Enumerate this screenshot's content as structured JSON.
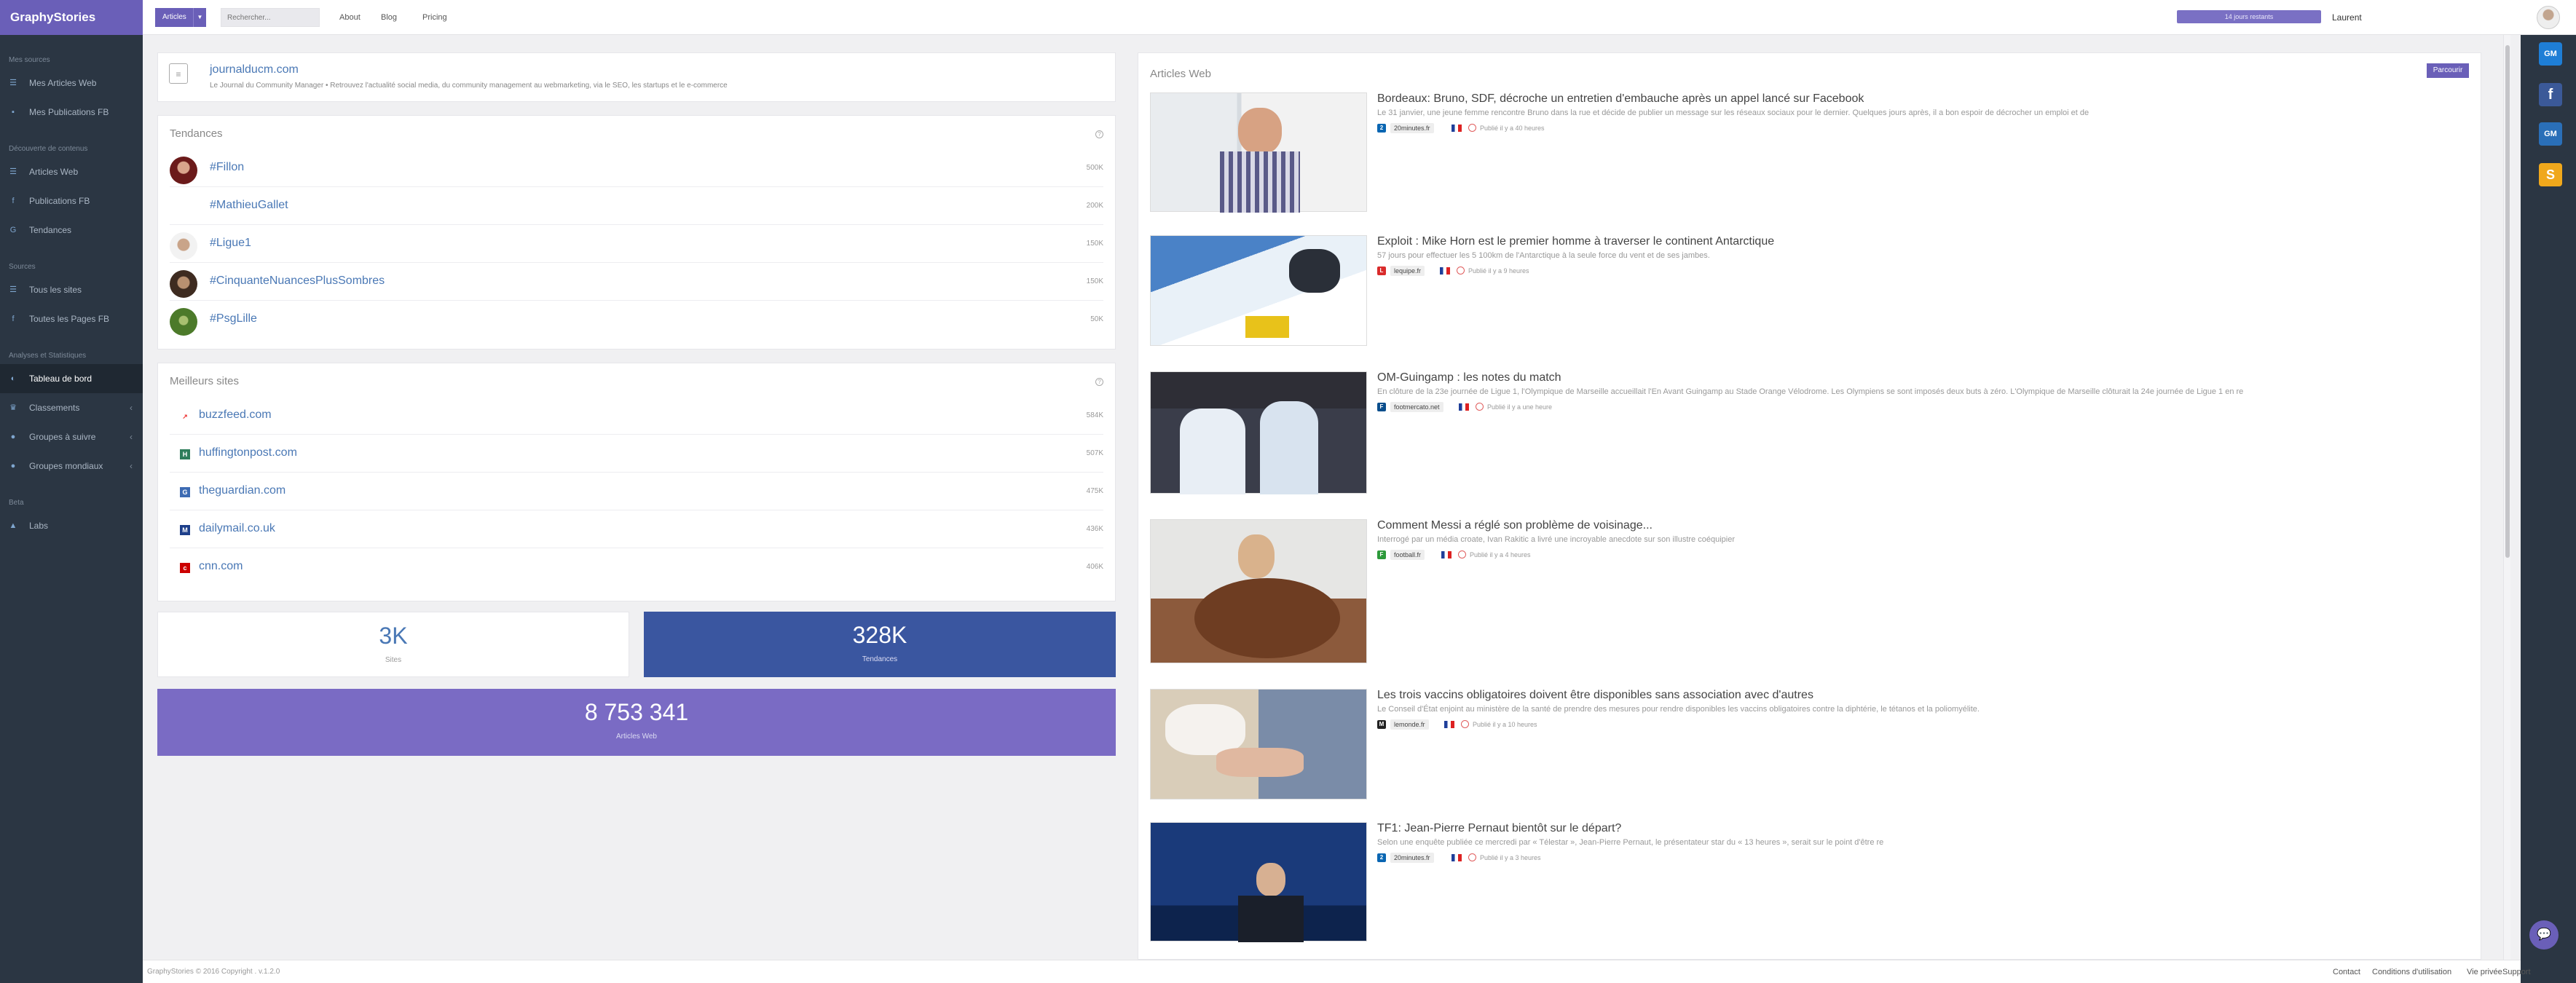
{
  "brand": "GraphyStories",
  "sidebar": {
    "sections": [
      {
        "label": "Mes sources",
        "items": [
          {
            "label": "Mes Articles Web",
            "icon": "list-icon"
          },
          {
            "label": "Mes Publications FB",
            "icon": "facebook-icon"
          }
        ]
      },
      {
        "label": "Découverte de contenus",
        "items": [
          {
            "label": "Articles Web",
            "icon": "list-icon"
          },
          {
            "label": "Publications FB",
            "icon": "facebook-icon"
          },
          {
            "label": "Tendances",
            "icon": "hashtag-icon"
          }
        ]
      },
      {
        "label": "Sources",
        "items": [
          {
            "label": "Tous les sites",
            "icon": "list-icon"
          },
          {
            "label": "Toutes les Pages FB",
            "icon": "facebook-icon"
          }
        ]
      },
      {
        "label": "Analyses et Statistiques",
        "items": [
          {
            "label": "Tableau de bord",
            "icon": "dashboard-icon"
          },
          {
            "label": "Classements",
            "icon": "trophy-icon"
          },
          {
            "label": "Groupes à suivre",
            "icon": "globe-icon"
          },
          {
            "label": "Groupes mondiaux",
            "icon": "globe-icon"
          }
        ]
      },
      {
        "label": "Beta",
        "items": [
          {
            "label": "Labs",
            "icon": "flask-icon"
          }
        ]
      }
    ]
  },
  "topbar": {
    "scope": "Articles",
    "search_placeholder": "Rechercher...",
    "links": [
      "About",
      "Blog",
      "Pricing"
    ],
    "quota": "14 jours restants",
    "user": "Laurent"
  },
  "journal": {
    "name": "journalducm.com",
    "desc": "Le Journal du Community Manager • Retrouvez l'actualité social media, du community management au webmarketing, via le SEO, les startups et le e-commerce"
  },
  "tendances": {
    "title": "Tendances",
    "items": [
      {
        "label": "#Fillon",
        "value": "500K"
      },
      {
        "label": "#MathieuGallet",
        "value": "200K"
      },
      {
        "label": "#Ligue1",
        "value": "150K"
      },
      {
        "label": "#CinquanteNuancesPlusSombres",
        "value": "150K"
      },
      {
        "label": "#PsgLille",
        "value": "50K"
      }
    ]
  },
  "sites": {
    "title": "Meilleurs sites",
    "items": [
      {
        "label": "buzzfeed.com",
        "value": "584K"
      },
      {
        "label": "huffingtonpost.com",
        "value": "507K"
      },
      {
        "label": "theguardian.com",
        "value": "475K"
      },
      {
        "label": "dailymail.co.uk",
        "value": "436K"
      },
      {
        "label": "cnn.com",
        "value": "406K"
      }
    ]
  },
  "stats": {
    "sites_num": "3K",
    "sites_lbl": "Sites",
    "tend_num": "328K",
    "tend_lbl": "Tendances",
    "art_num": "8 753 341",
    "art_lbl": "Articles Web"
  },
  "articles": {
    "title": "Articles Web",
    "browse": "Parcourir",
    "items": [
      {
        "title": "Bordeaux: Bruno, SDF, décroche un entretien d'embauche après un appel lancé sur Facebook",
        "excerpt": "Le 31 janvier, une jeune femme rencontre Bruno dans la rue et décide de publier un message sur les réseaux sociaux pour le dernier. Quelques jours après, il a bon espoir de décrocher un emploi et de",
        "source": "20minutes.fr",
        "published": "Publié il y a 40 heures"
      },
      {
        "title": "Exploit : Mike Horn est le premier homme à traverser le continent Antarctique",
        "excerpt": "57 jours pour effectuer les 5 100km de l'Antarctique à la seule force du vent et de ses jambes.",
        "source": "lequipe.fr",
        "published": "Publié il y a 9 heures"
      },
      {
        "title": "OM-Guingamp : les notes du match",
        "excerpt": "En clôture de la 23e journée de Ligue 1, l'Olympique de Marseille accueillait l'En Avant Guingamp au Stade Orange Vélodrome. Les Olympiens se sont imposés deux buts à zéro. L'Olympique de Marseille clôturait la 24e journée de Ligue 1 en re",
        "source": "footmercato.net",
        "published": "Publié il y a une heure"
      },
      {
        "title": "Comment Messi a réglé son problème de voisinage...",
        "excerpt": "Interrogé par un média croate, Ivan Rakitic a livré une incroyable anecdote sur son illustre coéquipier",
        "source": "football.fr",
        "published": "Publié il y a 4 heures"
      },
      {
        "title": "Les trois vaccins obligatoires doivent être disponibles sans association avec d'autres",
        "excerpt": "Le Conseil d'État enjoint au ministère de la santé de prendre des mesures pour rendre disponibles les vaccins obligatoires contre la diphtérie, le tétanos et la poliomyélite.",
        "source": "lemonde.fr",
        "published": "Publié il y a 10 heures"
      },
      {
        "title": "TF1: Jean-Pierre Pernaut bientôt sur le départ?",
        "excerpt": "Selon une enquête publiée ce mercredi par « Télestar », Jean-Pierre Pernaut, le présentateur star du « 13 heures », serait sur le point d'être re",
        "source": "20minutes.fr",
        "published": "Publié il y a 3 heures"
      }
    ]
  },
  "rightbar": [
    "GM",
    "f",
    "GM",
    "S"
  ],
  "footer": {
    "copyright": "GraphyStories © 2016 Copyright . v.1.2.0",
    "links": [
      "Contact",
      "Conditions d'utilisation",
      "Vie privée",
      "Support"
    ]
  },
  "colors": {
    "brand": "#6a5fb8",
    "sidebar": "#2b3643",
    "link": "#4a78b5",
    "tendances_stat": "#3a56a0",
    "articles_stat": "#7a6bc4"
  }
}
